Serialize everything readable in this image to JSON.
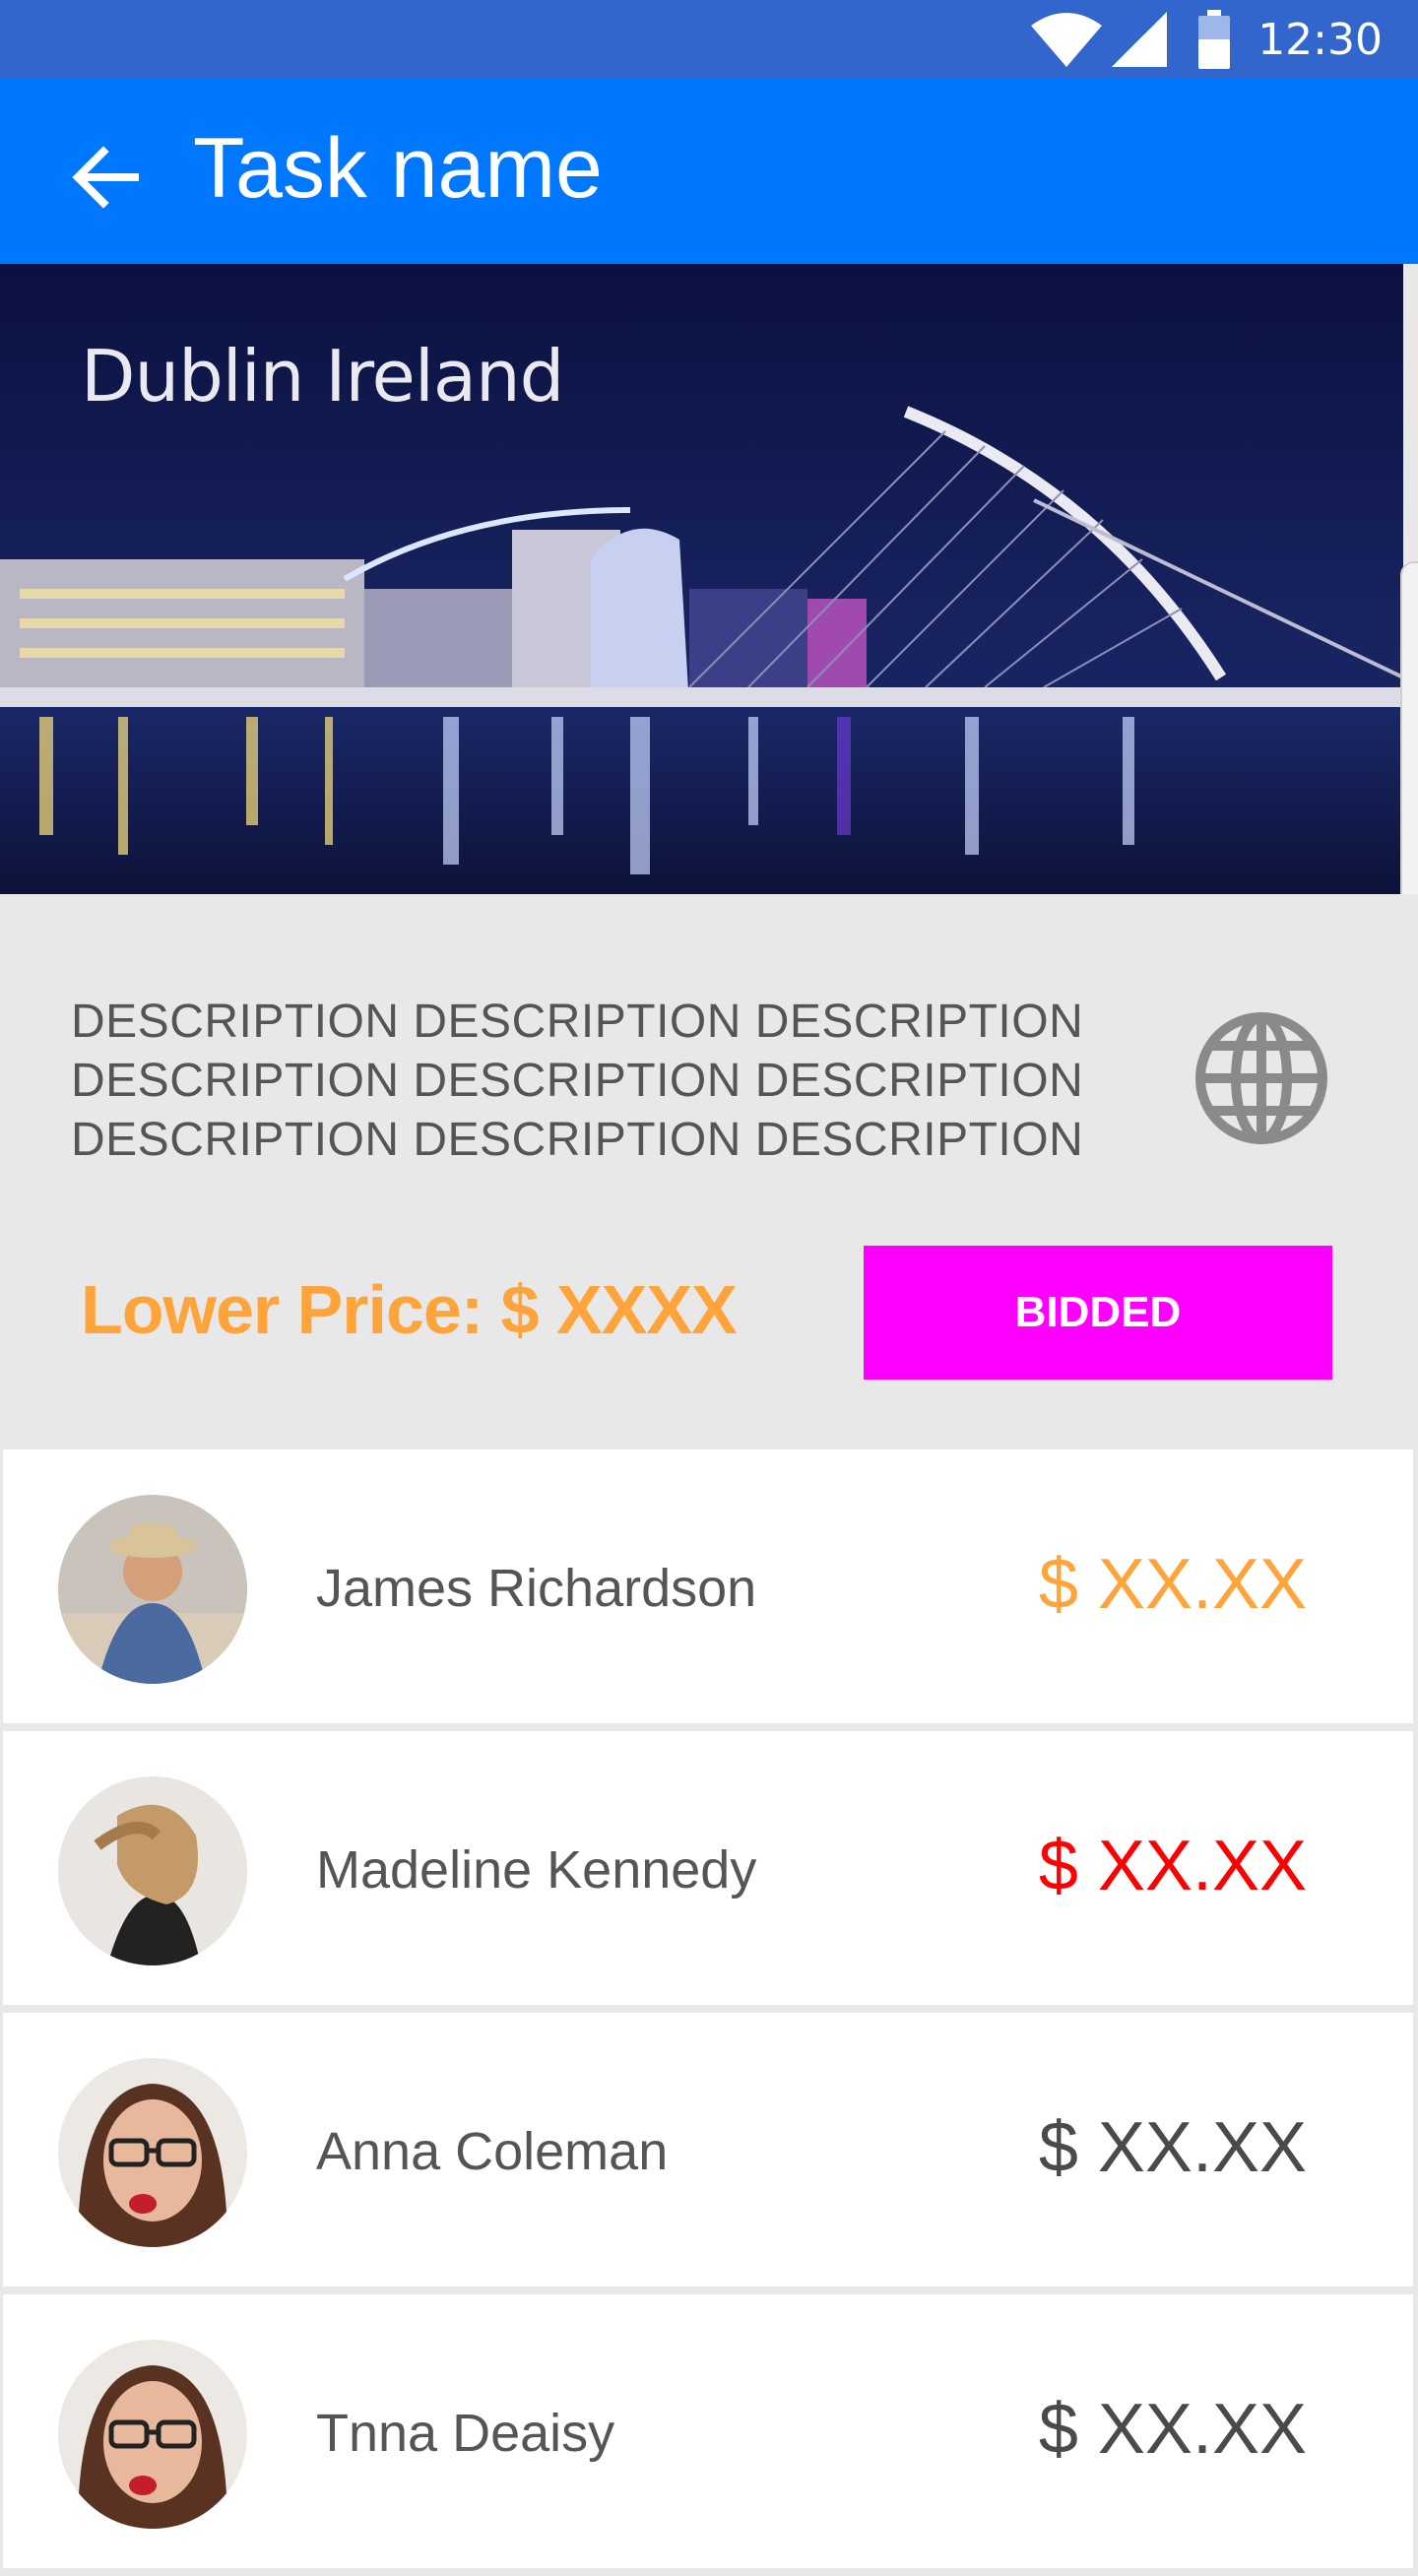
{
  "status_bar": {
    "time": "12:30"
  },
  "app_bar": {
    "title": "Task name"
  },
  "hero": {
    "caption": "Dublin Ireland"
  },
  "task": {
    "description": "DESCRIPTION DESCRIPTION DESCRIPTION DESCRIPTION DESCRIPTION DESCRIPTION DESCRIPTION DESCRIPTION DESCRIPTION",
    "lower_price": "Lower Price: $ XXXX",
    "status_button": "BIDDED"
  },
  "bids": [
    {
      "name": "James Richardson",
      "amount": "$ XX.XX",
      "amount_color": "#ffa43a"
    },
    {
      "name": "Madeline Kennedy",
      "amount": "$ XX.XX",
      "amount_color": "#ff0000"
    },
    {
      "name": "Anna Coleman",
      "amount": "$ XX.XX",
      "amount_color": "#4a4a4a"
    },
    {
      "name": "Tnna Deaisy",
      "amount": "$ XX.XX",
      "amount_color": "#4a4a4a"
    }
  ],
  "colors": {
    "status_bar": "#3366cc",
    "app_bar": "#0077ff",
    "accent_price": "#ffa43a",
    "bidded_button": "#ff00ff"
  }
}
